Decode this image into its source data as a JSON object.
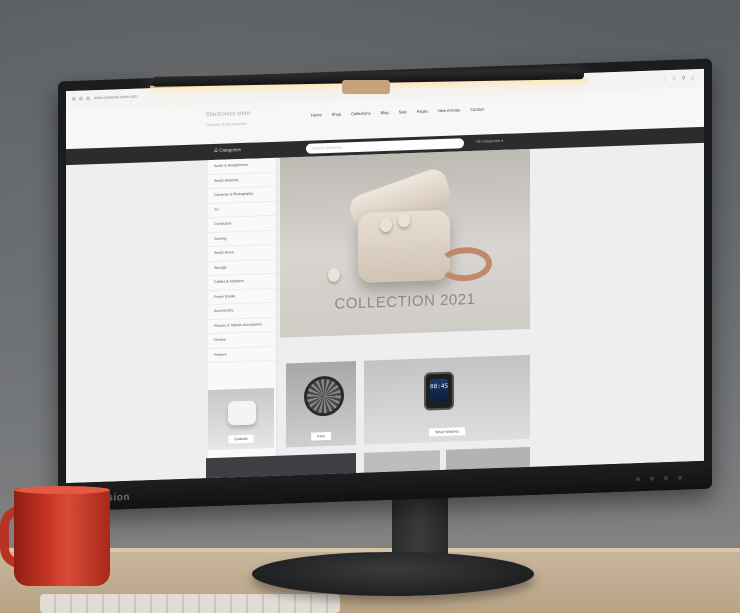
{
  "monitor": {
    "brand": "ThinkVision"
  },
  "browser": {
    "url": "www.example-store.com",
    "toolbar_icons": "⋮ ☆ ⚲ ⌂"
  },
  "site": {
    "logo": "Electronics store",
    "tagline": "Gadgets & accessories",
    "nav": [
      "Home",
      "Shop",
      "Collections",
      "Blog",
      "Sale",
      "Pages",
      "New Arrivals",
      "Contact"
    ],
    "categories_toggle": "☰ Categories",
    "search_placeholder": "Search products...",
    "search_category": "All categories ▾",
    "sidebar_items": [
      "Audio & Headphones",
      "Smart Watches",
      "Cameras & Photography",
      "TV",
      "Computers",
      "Gaming",
      "Smart Home",
      "Storage",
      "Cables & Adapters",
      "Power Banks",
      "Accessories",
      "Phones & Tablets Accessories",
      "Drones",
      "Printers"
    ],
    "hero_title": "COLLECTION 2021",
    "tiles": [
      {
        "label": "Earbuds"
      },
      {
        "label": "Fans"
      },
      {
        "label": "Smart Watches"
      }
    ],
    "watch_time": "08:45"
  }
}
